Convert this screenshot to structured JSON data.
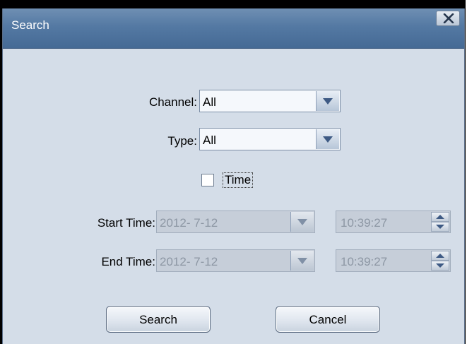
{
  "window": {
    "title": "Search"
  },
  "form": {
    "channel": {
      "label": "Channel:",
      "value": "All"
    },
    "type": {
      "label": "Type:",
      "value": "All"
    },
    "time_checkbox": {
      "label": "Time",
      "checked": false
    },
    "start_time": {
      "label": "Start Time:",
      "date": "2012- 7-12",
      "time": "10:39:27"
    },
    "end_time": {
      "label": "End Time:",
      "date": "2012- 7-12",
      "time": "10:39:27"
    }
  },
  "buttons": {
    "search": "Search",
    "cancel": "Cancel"
  },
  "colors": {
    "titlebar": "#5479a3",
    "client": "#d4dde8",
    "disabled_field": "#c6ced9"
  }
}
